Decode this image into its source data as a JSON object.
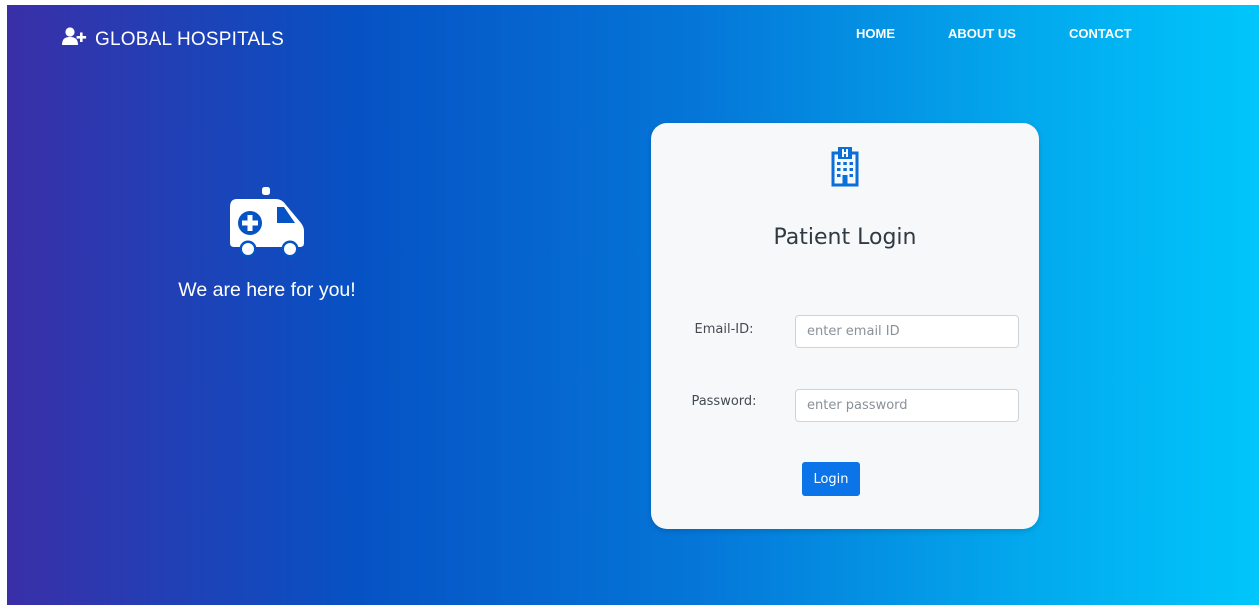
{
  "brand": {
    "name": "GLOBAL HOSPITALS",
    "icon": "user-plus-icon"
  },
  "nav": {
    "items": [
      "HOME",
      "ABOUT US",
      "CONTACT"
    ]
  },
  "hero": {
    "icon": "ambulance-icon",
    "tagline": "We are here for you!"
  },
  "login_card": {
    "icon": "hospital-icon",
    "title": "Patient Login",
    "email": {
      "label": "Email-ID:",
      "placeholder": "enter email ID",
      "value": ""
    },
    "password": {
      "label": "Password:",
      "placeholder": "enter password",
      "value": ""
    },
    "submit_label": "Login"
  },
  "colors": {
    "gradient_start": "#3a2fa8",
    "gradient_mid": "#0576d8",
    "gradient_end": "#00c6fb",
    "card_bg": "#f7f8fa",
    "primary_button": "#0a74e8",
    "icon_blue": "#0a6fd8"
  }
}
